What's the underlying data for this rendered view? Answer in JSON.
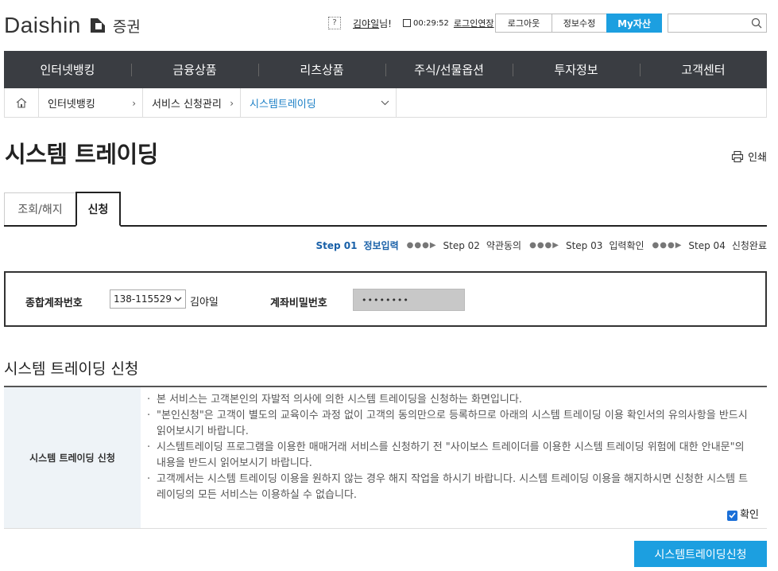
{
  "header": {
    "brand": "Daishin",
    "brand_sub": "증권",
    "help_icon": "?",
    "user_name": "김야일",
    "user_suffix": "님!",
    "session_time": "00:29:52",
    "extend_label": "로그인연장",
    "logout_label": "로그아웃",
    "info_edit_label": "정보수정",
    "my_asset_label": "My자산",
    "search_placeholder": ""
  },
  "gnb": {
    "items": [
      "인터넷뱅킹",
      "금융상품",
      "리츠상품",
      "주식/선물옵션",
      "투자정보",
      "고객센터"
    ]
  },
  "breadcrumb": {
    "items": [
      "인터넷뱅킹",
      "서비스 신청관리",
      "시스템트레이딩"
    ]
  },
  "page": {
    "title": "시스템 트레이딩",
    "print_label": "인쇄"
  },
  "tabs": [
    "조회/해지",
    "신청"
  ],
  "steps": [
    {
      "num": "Step 01",
      "label": "정보입력"
    },
    {
      "num": "Step 02",
      "label": "약관동의"
    },
    {
      "num": "Step 03",
      "label": "입력확인"
    },
    {
      "num": "Step 04",
      "label": "신청완료"
    }
  ],
  "account": {
    "label": "종합계좌번호",
    "selected": "138-115529",
    "holder": "김야일",
    "pw_label": "계좌비밀번호",
    "pw_mask": "••••••••"
  },
  "section": {
    "title": "시스템 트레이딩 신청",
    "row_header": "시스템 트레이딩 신청",
    "bullets": [
      "본 서비스는 고객본인의 자발적 의사에 의한 시스템 트레이딩을 신청하는 화면입니다.",
      "\"본인신청\"은 고객이 별도의 교육이수 과정 없이 고객의 동의만으로 등록하므로 아래의 시스템 트레이딩 이용 확인서의 유의사항을 반드시 읽어보시기 바랍니다.",
      "시스템트레이딩 프로그램을 이용한 매매거래 서비스를 신청하기 전 \"사이보스 트레이더를 이용한 시스템 트레이딩 위험에 대한 안내문\"의 내용을 반드시 읽어보시기 바랍니다.",
      "고객께서는 시스템 트레이딩 이용을 원하지 않는 경우 해지 작업을 하시기 바랍니다. 시스템 트레이딩 이용을 해지하시면 신청한 시스템 트레이딩의 모든 서비스는 이용하실 수 없습니다."
    ],
    "confirm_label": "확인",
    "confirm_checked": true
  },
  "submit_label": "시스템트레이딩신청",
  "colors": {
    "accent": "#1c9fe0",
    "gnb_bg": "#3a3d42",
    "step_active": "#1860a8"
  }
}
